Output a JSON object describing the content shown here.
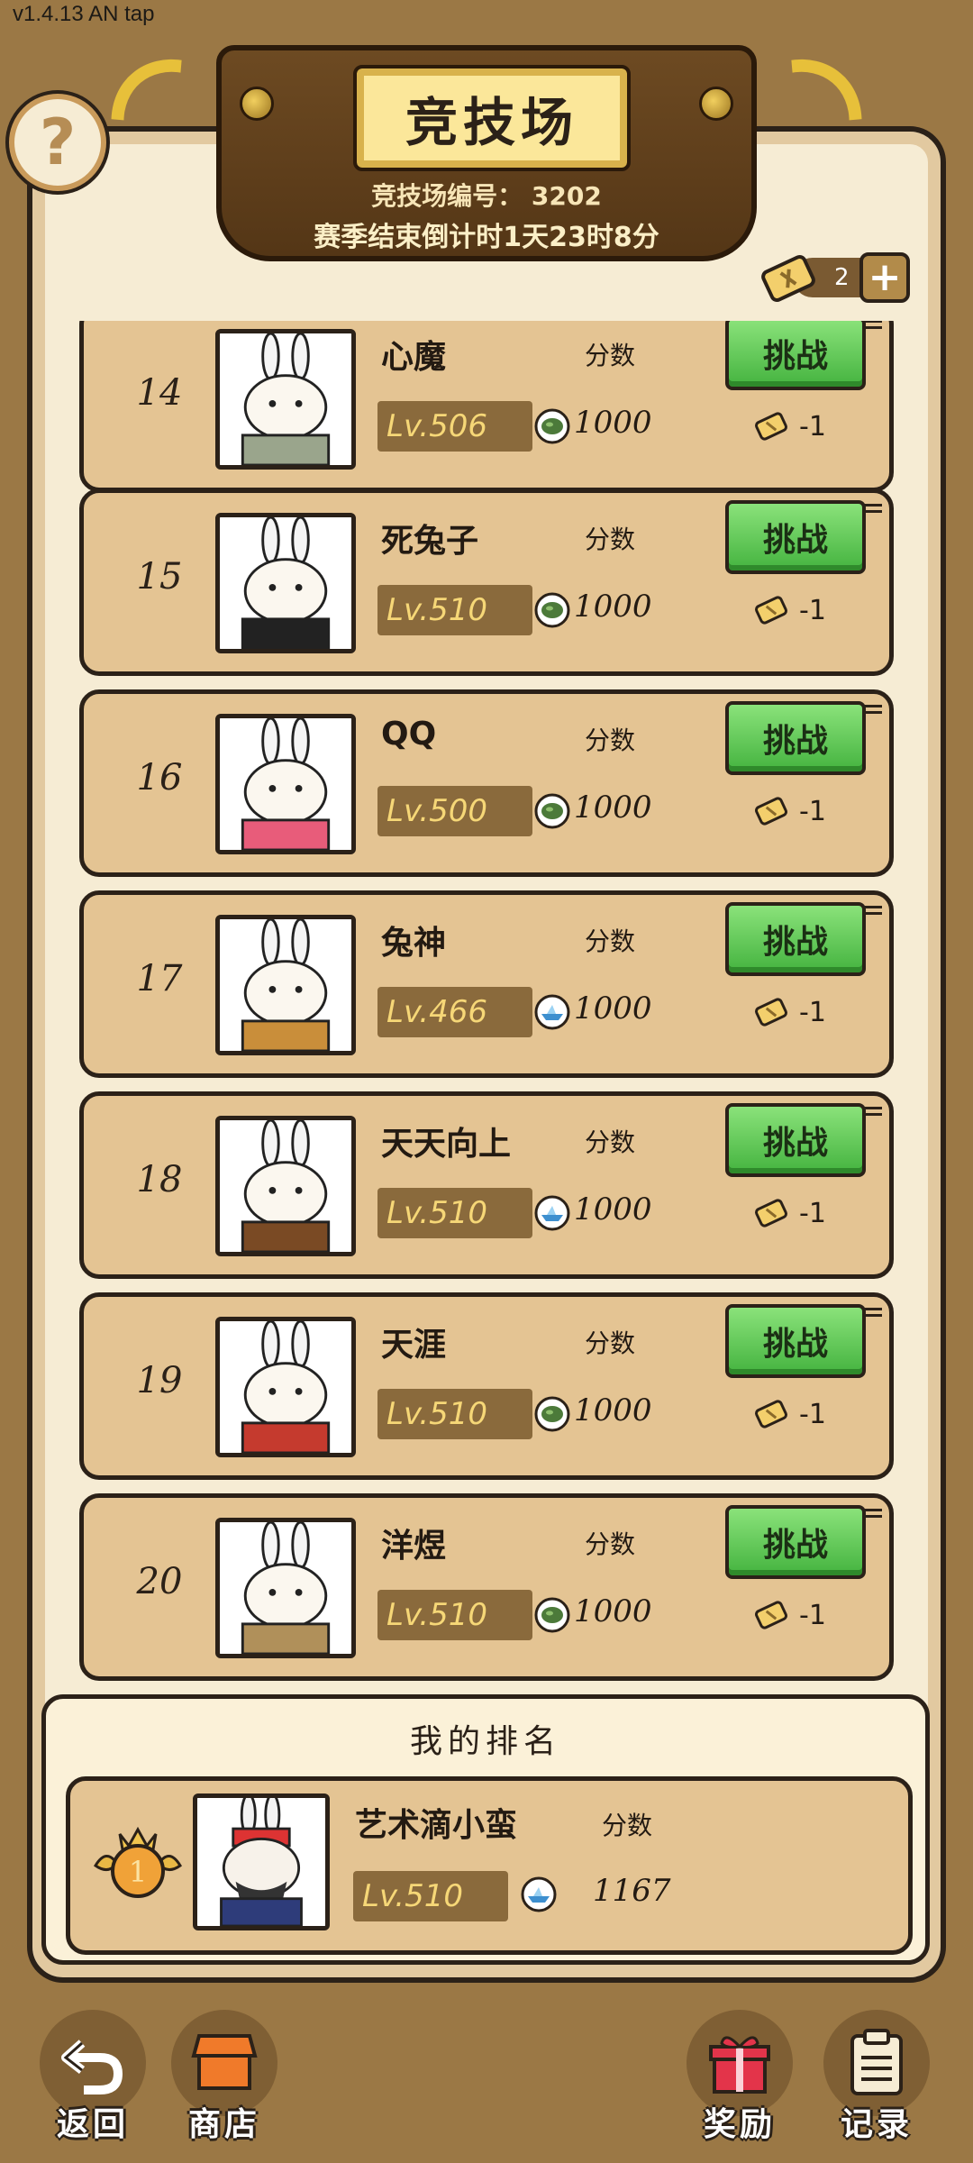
{
  "status": {
    "version": "v1.4.13 AN tap"
  },
  "header": {
    "title": "竞技场",
    "arena_number": "竞技场编号： 3202",
    "countdown": "赛季结束倒计时1天23时8分",
    "help_symbol": "?"
  },
  "tickets": {
    "count": "2",
    "plus_symbol": "+"
  },
  "rows": [
    {
      "rank": "14",
      "name": "心魔",
      "score_label": "分数",
      "level": "Lv.506",
      "score": "1000",
      "challenge": "挑战",
      "cost": "-1",
      "rank_icon": "pickle-rank-icon"
    },
    {
      "rank": "15",
      "name": "死兔子",
      "score_label": "分数",
      "level": "Lv.510",
      "score": "1000",
      "challenge": "挑战",
      "cost": "-1",
      "rank_icon": "pickle-rank-icon"
    },
    {
      "rank": "16",
      "name": "QQ",
      "score_label": "分数",
      "level": "Lv.500",
      "score": "1000",
      "challenge": "挑战",
      "cost": "-1",
      "rank_icon": "pickle-rank-icon"
    },
    {
      "rank": "17",
      "name": "兔神",
      "score_label": "分数",
      "level": "Lv.466",
      "score": "1000",
      "challenge": "挑战",
      "cost": "-1",
      "rank_icon": "boat-rank-icon"
    },
    {
      "rank": "18",
      "name": "天天向上",
      "score_label": "分数",
      "level": "Lv.510",
      "score": "1000",
      "challenge": "挑战",
      "cost": "-1",
      "rank_icon": "boat-rank-icon"
    },
    {
      "rank": "19",
      "name": "天涯",
      "score_label": "分数",
      "level": "Lv.510",
      "score": "1000",
      "challenge": "挑战",
      "cost": "-1",
      "rank_icon": "pickle-rank-icon"
    },
    {
      "rank": "20",
      "name": "洋煜",
      "score_label": "分数",
      "level": "Lv.510",
      "score": "1000",
      "challenge": "挑战",
      "cost": "-1",
      "rank_icon": "pickle-rank-icon"
    }
  ],
  "my_rank": {
    "title": "我的排名",
    "medal_number": "1",
    "name": "艺术滴小蛮",
    "score_label": "分数",
    "level": "Lv.510",
    "score": "1167",
    "rank_icon": "boat-rank-icon"
  },
  "nav": {
    "back": "返回",
    "shop": "商店",
    "rewards": "奖励",
    "records": "记录"
  },
  "colors": {
    "background": "#9b7845",
    "board": "#f6ecd4",
    "row": "#e4c493",
    "challenge_green": "#44b33f",
    "level_gold": "#f6d777"
  }
}
